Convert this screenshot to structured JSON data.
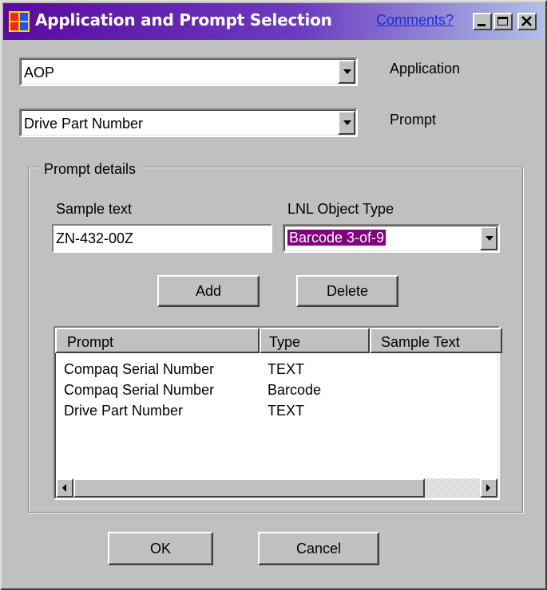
{
  "window": {
    "title": "Application and Prompt Selection",
    "comments_link": "Comments?"
  },
  "application": {
    "value": "AOP",
    "label": "Application"
  },
  "prompt": {
    "value": "Drive Part Number",
    "label": "Prompt"
  },
  "details": {
    "group_label": "Prompt details",
    "sample_text_label": "Sample text",
    "sample_text_value": "ZN-432-00Z",
    "object_type_label": "LNL Object Type",
    "object_type_value": "Barcode 3-of-9",
    "add_label": "Add",
    "delete_label": "Delete",
    "columns": [
      "Prompt",
      "Type",
      "Sample Text"
    ],
    "rows": [
      {
        "prompt": "Compaq Serial Number",
        "type": "TEXT"
      },
      {
        "prompt": "Compaq Serial Number",
        "type": "Barcode"
      },
      {
        "prompt": "Drive Part Number",
        "type": "TEXT"
      }
    ]
  },
  "footer": {
    "ok_label": "OK",
    "cancel_label": "Cancel"
  },
  "colors": {
    "selection": "#800080",
    "link": "#1a2fd6",
    "face": "#c0c0c0"
  },
  "icons": [
    "app-icon",
    "minimize-icon",
    "maximize-icon",
    "close-icon",
    "dropdown-arrow-icon",
    "scroll-left-icon",
    "scroll-right-icon"
  ]
}
